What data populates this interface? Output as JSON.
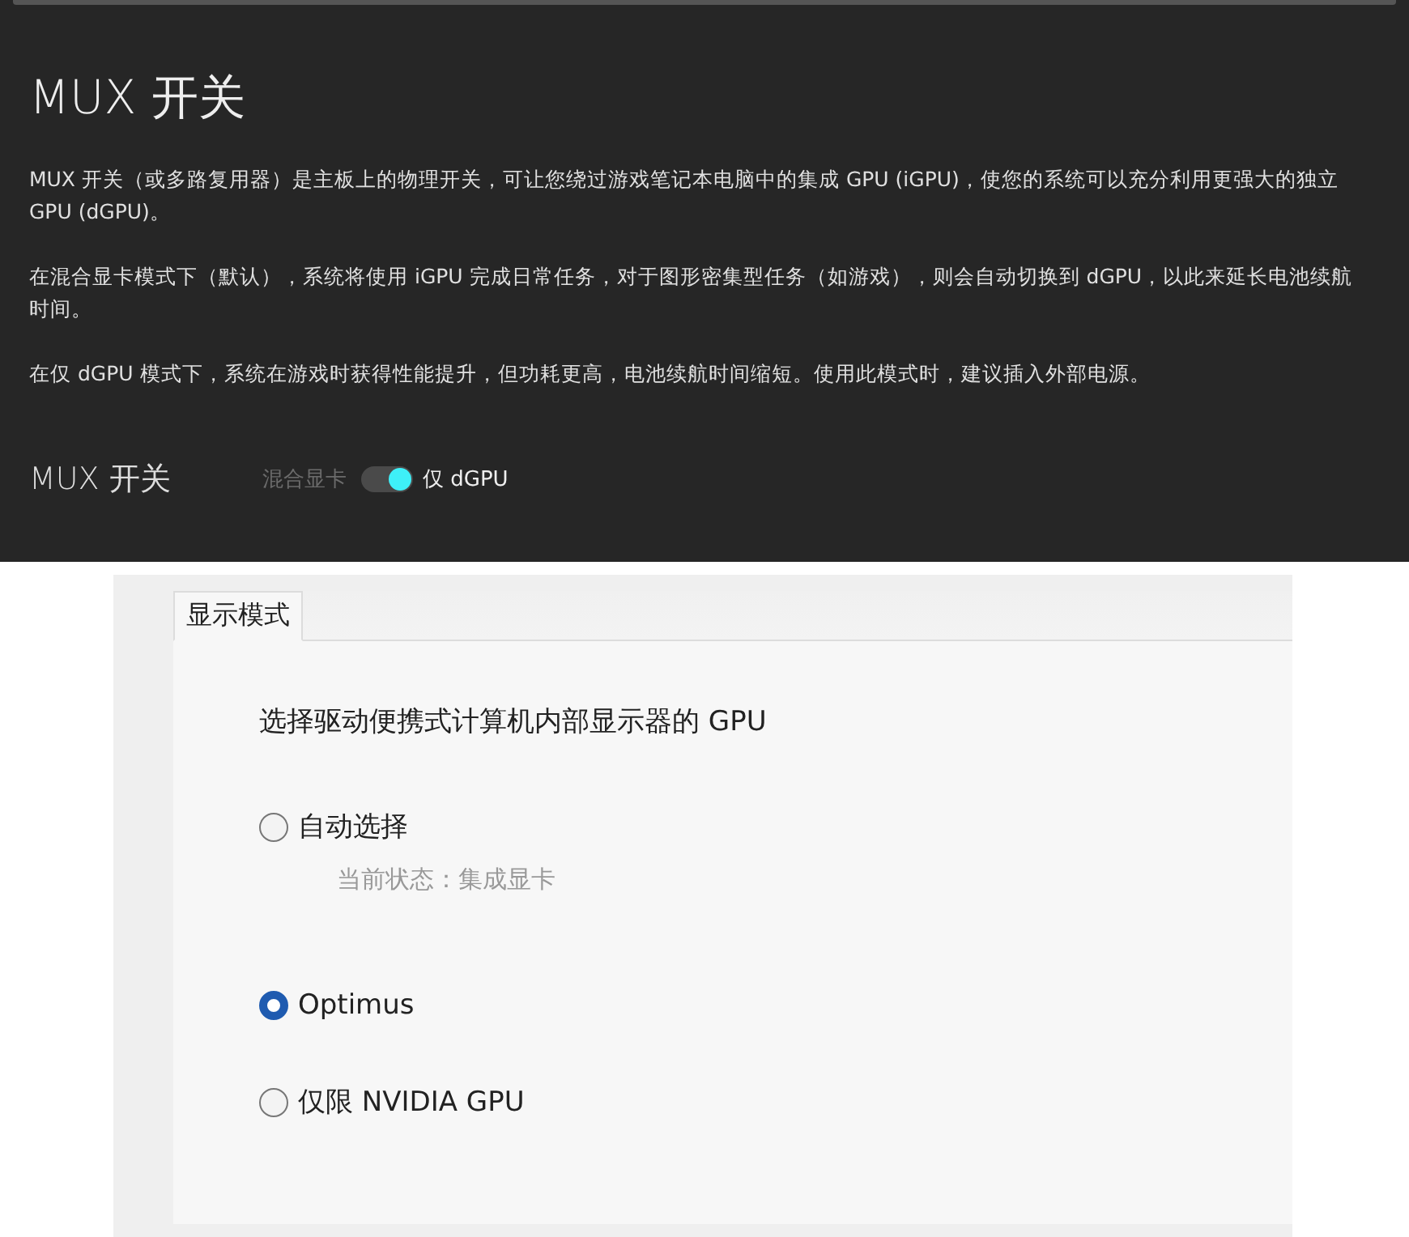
{
  "dark_panel": {
    "title": "MUX 开关",
    "paragraphs": [
      "MUX 开关（或多路复用器）是主板上的物理开关，可让您绕过游戏笔记本电脑中的集成 GPU (iGPU)，使您的系统可以充分利用更强大的独立 GPU (dGPU)。",
      "在混合显卡模式下（默认），系统将使用 iGPU 完成日常任务，对于图形密集型任务（如游戏），则会自动切换到 dGPU，以此来延长电池续航时间。",
      "在仅 dGPU 模式下，系统在游戏时获得性能提升，但功耗更高，电池续航时间缩短。使用此模式时，建议插入外部电源。"
    ],
    "setting": {
      "label": "MUX 开关",
      "off_label": "混合显卡",
      "on_label": "仅 dGPU",
      "on": true
    }
  },
  "dialog": {
    "tabs": [
      {
        "label": "显示模式",
        "selected": true
      }
    ],
    "heading": "选择驱动便携式计算机内部显示器的 GPU",
    "options": [
      {
        "label": "自动选择",
        "selected": false,
        "status": "当前状态：集成显卡"
      },
      {
        "label": "Optimus",
        "selected": true
      },
      {
        "label": "仅限 NVIDIA GPU",
        "selected": false
      }
    ]
  }
}
